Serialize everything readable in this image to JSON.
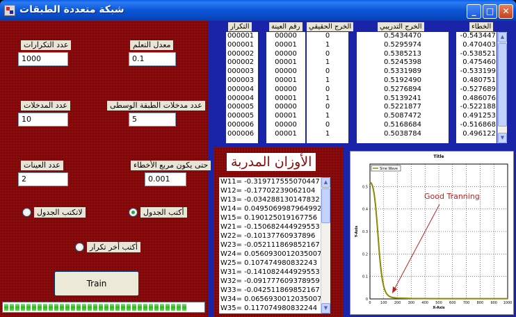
{
  "window": {
    "title": "شبكة متعددة الطبقات",
    "buttons": {
      "minimize": "_",
      "maximize": "□",
      "close": "✕"
    }
  },
  "left_panel": {
    "iterations": {
      "label": "عدد التكرارات",
      "value": "1000"
    },
    "learning_rate": {
      "label": "معدل التعلم",
      "value": "0.1"
    },
    "inputs": {
      "label": "عدد المدخلات",
      "value": "10"
    },
    "hidden_inputs": {
      "label": "عدد مدخلات الطبقة الوسطى",
      "value": "5"
    },
    "samples": {
      "label": "عدد العينات",
      "value": "2"
    },
    "error_target": {
      "label": "حتى يكون مربع الأخطاء",
      "value": "0.001"
    },
    "radio_no_table": {
      "label": "لاتكتب الجدول",
      "checked": false
    },
    "radio_table": {
      "label": "أكتب الجدول",
      "checked": true
    },
    "radio_last": {
      "label": "أكتب أخر تكرار",
      "checked": false
    },
    "train_button": "Train",
    "progress": {
      "segments_filled": 33,
      "fraction": 0.73
    }
  },
  "table": {
    "headers": {
      "iteration": "التكرار",
      "sample": "رقم العينة",
      "actual": "الخرج الحقيقي",
      "training": "الخرج التدريبي",
      "error": "الخطاء"
    },
    "iterations": [
      "000001",
      "000001",
      "000002",
      "000002",
      "000003",
      "000003",
      "000004",
      "000004",
      "000005",
      "000005",
      "000006",
      "000006"
    ],
    "samples": [
      "00000",
      "00001",
      "00000",
      "00001",
      "00000",
      "00001",
      "00000",
      "00001",
      "00000",
      "00001",
      "00000",
      "00001"
    ],
    "actual": [
      "0",
      "1",
      "0",
      "1",
      "0",
      "1",
      "0",
      "1",
      "0",
      "1",
      "0",
      "1"
    ],
    "training": [
      "0.5434470",
      "0.5295974",
      "0.5385213",
      "0.5245398",
      "0.5331989",
      "0.5192490",
      "0.5276894",
      "0.5139241",
      "0.5221877",
      "0.5087472",
      "0.5168684",
      "0.5038784"
    ],
    "errors": [
      "-0.543447",
      "0.470403",
      "-0.538521",
      "0.475460",
      "-0.533199",
      "0.480751",
      "-0.527689",
      "0.486076",
      "-0.522188",
      "0.491253",
      "-0.516868",
      "0.496122"
    ]
  },
  "weights": {
    "title": "الأوزان المدربة",
    "items": [
      "W11= -0.319717555070447",
      "W12= -0.17702239062104",
      "W13= -0.03428813014783​2",
      "W14= 0.049506998796499​2",
      "W15= 0.190125019167756",
      "W21= -0.150682444929553",
      "W22= -0.10137760937896",
      "W23= -0.052111869852167",
      "W24= 0.056093001203500​7",
      "W25= 0.107474980832243",
      "W31= -0.141082444929553",
      "W32= -0.091777609378959",
      "W33= -0.042511869852167",
      "W34= 0.065693001203500​7",
      "W35= 0.117074980832244"
    ]
  },
  "chart_data": {
    "type": "line",
    "title": "Title",
    "xlabel": "X-Axis",
    "ylabel": "Y-Axis",
    "xlim": [
      0,
      1000
    ],
    "ylim": [
      0,
      0.6
    ],
    "xticks": [
      0,
      100,
      200,
      300,
      400,
      500,
      600,
      700,
      800,
      900,
      1000
    ],
    "yticks": [
      0,
      0.1,
      0.2,
      0.3,
      0.4,
      0.5
    ],
    "legend": "top-left",
    "series": [
      {
        "name": "Sine Wave",
        "color": "#8a8a00",
        "x": [
          0,
          10,
          20,
          30,
          40,
          50,
          60,
          70,
          80,
          90,
          100,
          110,
          120,
          130,
          140,
          150,
          160,
          180,
          200,
          250,
          300,
          400,
          500,
          600,
          700,
          800,
          900,
          1000
        ],
        "y": [
          0.52,
          0.515,
          0.5,
          0.47,
          0.42,
          0.35,
          0.27,
          0.19,
          0.13,
          0.085,
          0.055,
          0.036,
          0.024,
          0.017,
          0.012,
          0.009,
          0.007,
          0.005,
          0.004,
          0.003,
          0.002,
          0.0015,
          0.001,
          0.001,
          0.001,
          0.001,
          0.001,
          0.001
        ]
      }
    ],
    "annotation": {
      "text": "Good Tranning",
      "color": "#c02020"
    }
  }
}
